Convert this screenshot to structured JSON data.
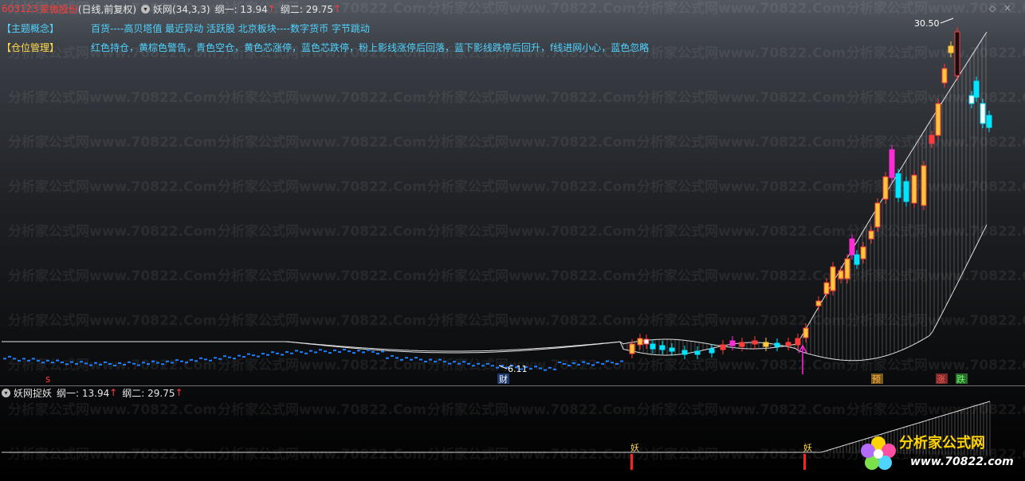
{
  "header": {
    "code": "603123",
    "name": "翠微股份",
    "period": "(日线,前复权)",
    "indicator": "妖网(34,3,3)",
    "gang1": "纲一: 13.94",
    "gang2": "纲二: 29.75"
  },
  "info": {
    "concept_label": "【主题概念】",
    "concept_text": "百货----高贝塔值 最近异动 活跃股 北京板块----数字货币 字节跳动",
    "position_label": "【仓位管理】",
    "position_text": "红色持仓，黄棕色警告，青色空仓，黄色芯涨停，蓝色芯跌停，粉上影线涨停后回落，蓝下影线跌停后回升，f线进网小心，蓝色忽略"
  },
  "chart": {
    "high_label": "30.50",
    "low_label": "6.11",
    "mark_s": "s",
    "mark_cai": "财",
    "mark_yu": "预",
    "mark_zhang": "涨",
    "mark_die": "跌"
  },
  "sub": {
    "title": "妖网捉妖",
    "gang1": "纲一: 13.94",
    "gang2": "纲二: 29.75",
    "yao1": "妖",
    "yao2": "妖"
  },
  "watermark": "分析家公式网www.70822.Com",
  "logo": {
    "name": "分析家公式网",
    "url": "www.70822.com"
  },
  "colors": {
    "up": "#ff3b3b",
    "down": "#00e5ff",
    "warn": "#ffc83a",
    "flat": "#1e7fff",
    "pink": "#ff2bd6",
    "accent": "#4fd3ff"
  }
}
